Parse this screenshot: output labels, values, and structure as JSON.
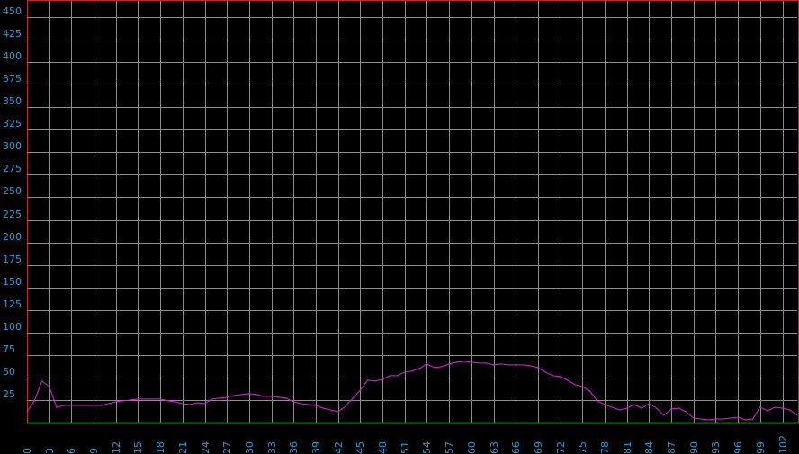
{
  "chart_data": {
    "type": "line",
    "title": "",
    "xlabel": "",
    "ylabel": "",
    "xlim": [
      0,
      104
    ],
    "ylim": [
      0,
      468
    ],
    "grid": true,
    "colors": {
      "background": "#000000",
      "grid": "#8c8c8c",
      "frame": "#c0282d",
      "baseline": "#2ecc2e",
      "series": "#e020e0",
      "tick_labels": "#2a9fd8"
    },
    "y_ticks": [
      25,
      50,
      75,
      100,
      125,
      150,
      175,
      200,
      225,
      250,
      275,
      300,
      325,
      350,
      375,
      400,
      425,
      450
    ],
    "x_ticks": [
      0,
      3,
      6,
      9,
      12,
      15,
      18,
      21,
      24,
      27,
      30,
      33,
      36,
      39,
      42,
      45,
      48,
      51,
      54,
      57,
      60,
      63,
      66,
      69,
      72,
      75,
      78,
      81,
      84,
      87,
      90,
      93,
      96,
      99,
      102
    ],
    "series": [
      {
        "x": [
          0,
          1,
          2,
          3,
          4,
          5,
          6,
          7,
          8,
          9,
          10,
          11,
          12,
          13,
          14,
          15,
          16,
          17,
          18,
          19,
          20,
          21,
          22,
          23,
          24,
          25,
          26,
          27,
          28,
          29,
          30,
          31,
          32,
          33,
          34,
          35,
          36,
          37,
          38,
          39,
          40,
          41,
          42,
          43,
          44,
          45,
          46,
          47,
          48,
          49,
          50,
          51,
          52,
          53,
          54,
          55,
          56,
          57,
          58,
          59,
          60,
          61,
          62,
          63,
          64,
          65,
          66,
          67,
          68,
          69,
          70,
          71,
          72,
          73,
          74,
          75,
          76,
          77,
          78,
          79,
          80,
          81,
          82,
          83,
          84,
          85,
          86,
          87,
          88,
          89,
          90,
          91,
          92,
          93,
          94,
          95,
          96,
          97,
          98,
          99,
          100,
          101,
          102,
          103,
          104
        ],
        "values": [
          12,
          24,
          46,
          40,
          17,
          19,
          19,
          19,
          19,
          19,
          19,
          21,
          23,
          24,
          25,
          26,
          26,
          26,
          26,
          24,
          23,
          21,
          20,
          22,
          21,
          26,
          27,
          28,
          30,
          31,
          32,
          31,
          29,
          29,
          28,
          27,
          23,
          21,
          20,
          19,
          16,
          14,
          12,
          18,
          27,
          36,
          47,
          46,
          48,
          52,
          52,
          56,
          57,
          60,
          65,
          61,
          62,
          65,
          67,
          68,
          67,
          66,
          66,
          64,
          65,
          64,
          64,
          64,
          63,
          61,
          56,
          52,
          51,
          47,
          42,
          40,
          35,
          24,
          20,
          17,
          14,
          16,
          20,
          16,
          21,
          16,
          8,
          15,
          16,
          12,
          5,
          4,
          3,
          4,
          4,
          5,
          6,
          3,
          4,
          17,
          13,
          17,
          16,
          14,
          8
        ]
      }
    ]
  }
}
